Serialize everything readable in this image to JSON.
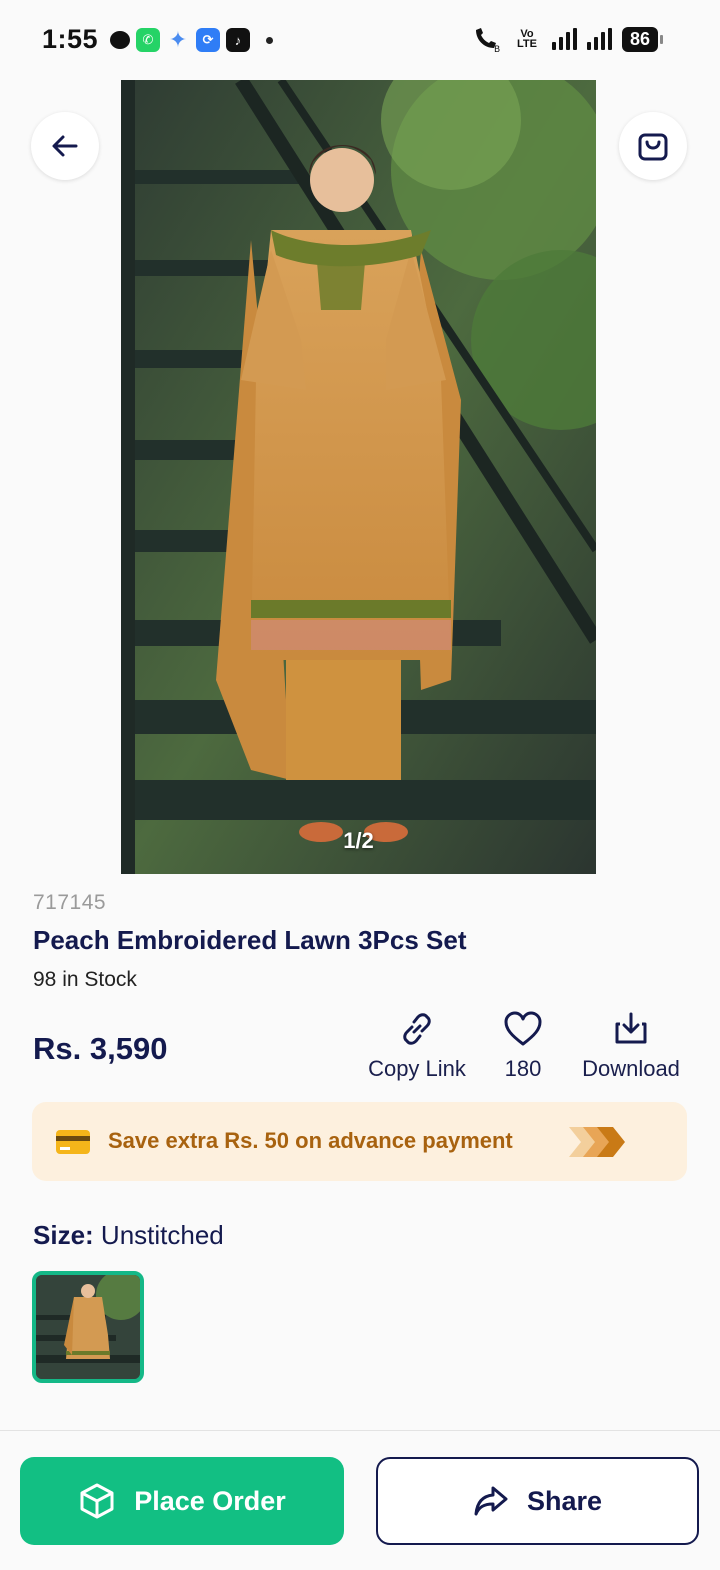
{
  "status_bar": {
    "time": "1:55",
    "volte_label": "Vo LTE",
    "battery": "86"
  },
  "product": {
    "image_counter": "1/2",
    "sku": "717145",
    "title": "Peach Embroidered Lawn 3Pcs Set",
    "stock": "98 in Stock",
    "price": "Rs. 3,590"
  },
  "actions": {
    "copy_link": "Copy Link",
    "likes": "180",
    "download": "Download"
  },
  "promo": {
    "text": "Save extra Rs. 50 on advance payment"
  },
  "size": {
    "label": "Size:",
    "value": "Unstitched"
  },
  "bottom": {
    "place_order": "Place Order",
    "share": "Share"
  },
  "colors": {
    "primary_green": "#12bf83",
    "navy": "#141a4e",
    "promo_bg": "#fdf0de",
    "promo_text": "#a8620f"
  }
}
